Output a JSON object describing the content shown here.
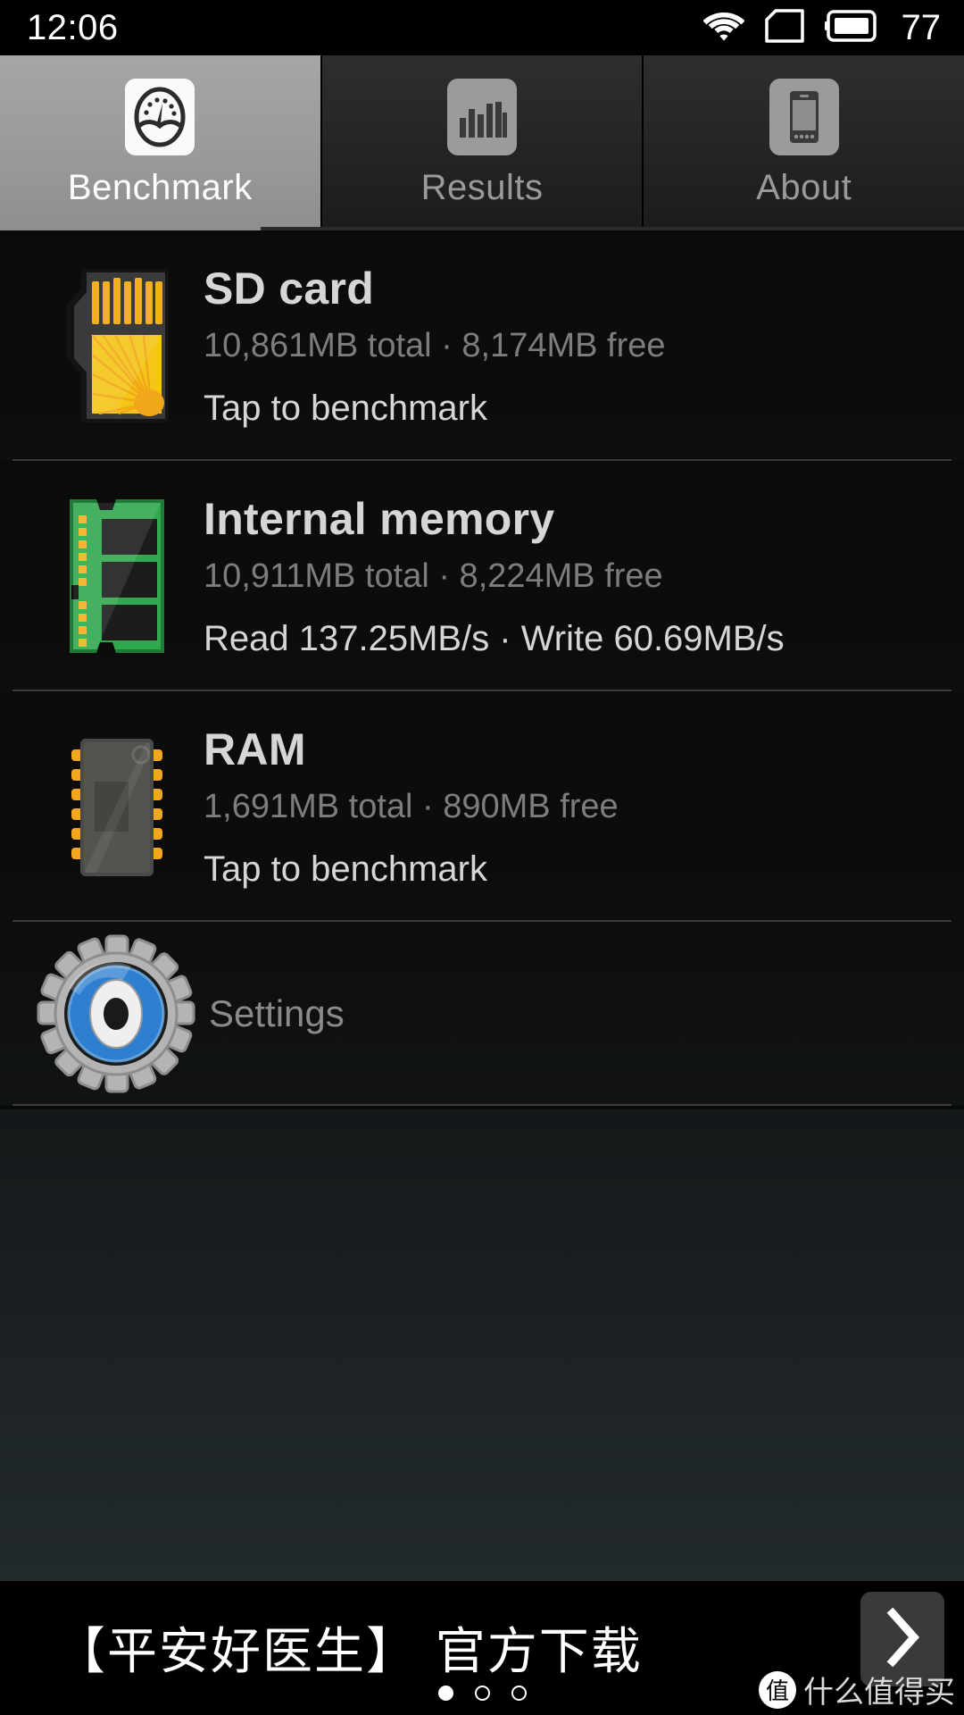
{
  "status_bar": {
    "time": "12:06",
    "battery_percent": "77",
    "icons": [
      "wifi-icon",
      "sim-card-icon",
      "battery-icon"
    ]
  },
  "tabs": [
    {
      "label": "Benchmark",
      "icon": "speedometer-icon",
      "active": true
    },
    {
      "label": "Results",
      "icon": "bar-chart-icon",
      "active": false
    },
    {
      "label": "About",
      "icon": "phone-icon",
      "active": false
    }
  ],
  "list": [
    {
      "title": "SD card",
      "subtitle": "10,861MB total · 8,174MB free",
      "action": "Tap to benchmark",
      "icon": "sd-card-icon",
      "total_mb": 10861,
      "free_mb": 8174
    },
    {
      "title": "Internal memory",
      "subtitle": "10,911MB total · 8,224MB free",
      "action": "Read 137.25MB/s · Write 60.69MB/s",
      "icon": "memory-stick-icon",
      "total_mb": 10911,
      "free_mb": 8224,
      "read_mb_s": 137.25,
      "write_mb_s": 60.69
    },
    {
      "title": "RAM",
      "subtitle": "1,691MB total · 890MB free",
      "action": "Tap to benchmark",
      "icon": "ram-chip-icon",
      "total_mb": 1691,
      "free_mb": 890
    }
  ],
  "settings": {
    "label": "Settings",
    "icon": "gear-icon"
  },
  "ad": {
    "text": "【平安好医生】 官方下载",
    "next_icon": "chevron-right-icon",
    "dots_total": 3,
    "dots_active_index": 0
  },
  "watermark": {
    "logo_char": "值",
    "text": "什么值得买"
  },
  "colors": {
    "active_tab_bg": "#9a9a9a",
    "inactive_tab_bg": "#262626",
    "sd_yellow": "#f5c518",
    "memory_green": "#2fa84f",
    "gear_blue": "#2f7fd0",
    "divider": "#3b3b3b"
  }
}
